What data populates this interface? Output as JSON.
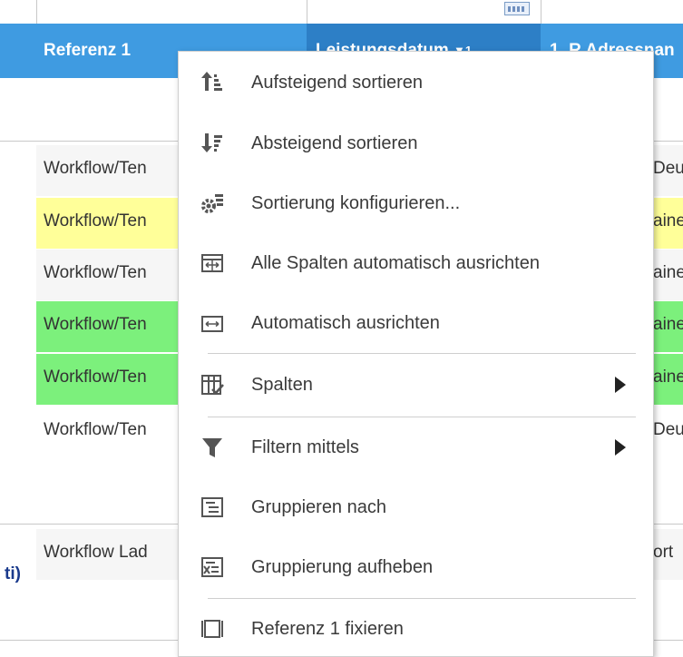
{
  "header": {
    "col1": "Referenz 1",
    "col2": "Leistungsdatum",
    "col2_sort": "1",
    "col3": "1. R Adressnan"
  },
  "rows": [
    {
      "left": "Workflow/Ten",
      "right": "Deu",
      "color": "#f6f6f6"
    },
    {
      "left": "Workflow/Ten",
      "right": "aine",
      "color": "#ffff99"
    },
    {
      "left": "Workflow/Ten",
      "right": "aine",
      "color": "#f6f6f6"
    },
    {
      "left": "Workflow/Ten",
      "right": "aine",
      "color": "#7cf07c"
    },
    {
      "left": "Workflow/Ten",
      "right": "aine",
      "color": "#7cf07c"
    },
    {
      "left": "Workflow/Ten",
      "right": "Deu",
      "color": "#ffffff"
    }
  ],
  "group_row": {
    "left": "Workflow Lad",
    "right": "ort"
  },
  "side_text": "ti)",
  "menu": {
    "items": [
      {
        "label": "Aufsteigend sortieren",
        "icon": "sort-ascending-icon"
      },
      {
        "label": "Absteigend sortieren",
        "icon": "sort-descending-icon"
      },
      {
        "label": "Sortierung konfigurieren...",
        "icon": "sort-config-icon"
      },
      {
        "label": "Alle Spalten automatisch ausrichten",
        "icon": "autofit-all-columns-icon"
      },
      {
        "label": "Automatisch ausrichten",
        "icon": "autofit-column-icon"
      },
      {
        "label": "Spalten",
        "icon": "columns-icon",
        "submenu": true
      },
      {
        "label": "Filtern mittels",
        "icon": "filter-icon",
        "submenu": true
      },
      {
        "label": "Gruppieren nach",
        "icon": "group-by-icon"
      },
      {
        "label": "Gruppierung aufheben",
        "icon": "ungroup-icon"
      },
      {
        "label": "Referenz 1 fixieren",
        "icon": "pin-column-icon"
      }
    ]
  },
  "colors": {
    "header_bg": "#3f9be1",
    "header_active_bg": "#2d7fc6",
    "row_yellow": "#ffff99",
    "row_green": "#7cf07c"
  }
}
